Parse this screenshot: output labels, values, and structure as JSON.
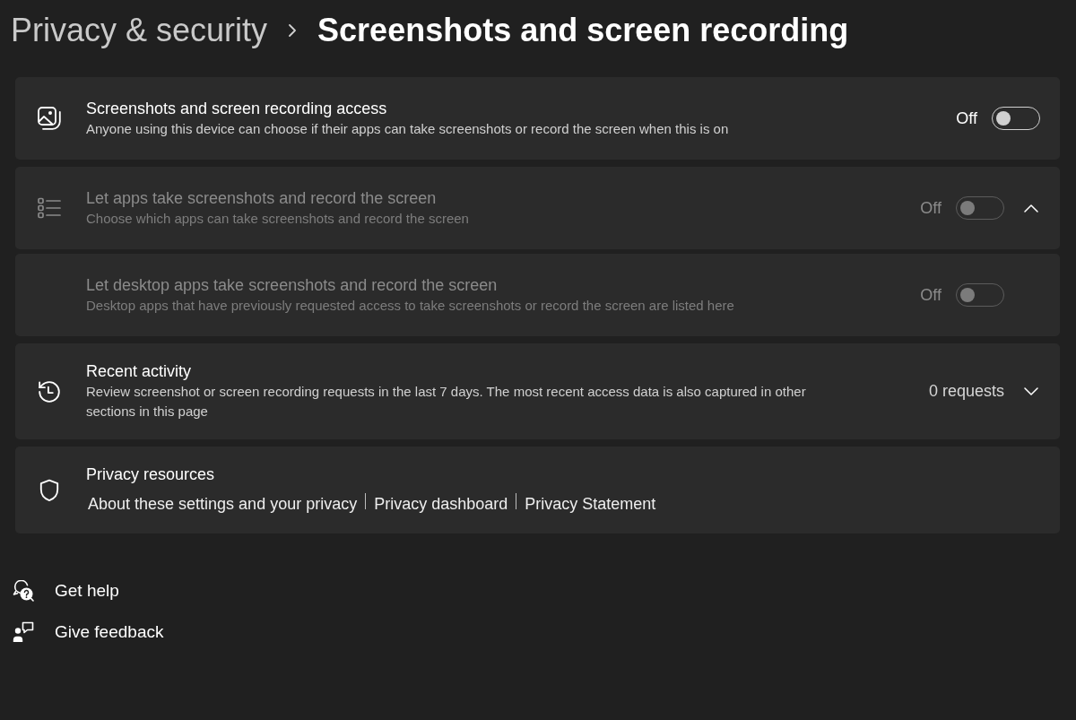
{
  "breadcrumb": {
    "parent": "Privacy & security",
    "current": "Screenshots and screen recording"
  },
  "settings": [
    {
      "kind": "toggle",
      "title": "Screenshots and screen recording access",
      "description": "Anyone using this device can choose if their apps can take screenshots or record the screen when this is on",
      "state_label": "Off",
      "on": false,
      "disabled": false
    },
    {
      "kind": "toggle",
      "title": "Let apps take screenshots and record the screen",
      "description": "Choose which apps can take screenshots and record the screen",
      "state_label": "Off",
      "on": false,
      "disabled": true,
      "expanded": true,
      "children": [
        {
          "kind": "toggle",
          "title": "Let desktop apps take screenshots and record the screen",
          "description": "Desktop apps that have previously requested access to take screenshots or record the screen are listed here",
          "state_label": "Off",
          "on": false,
          "disabled": true
        }
      ]
    },
    {
      "kind": "expander",
      "title": "Recent activity",
      "description": "Review screenshot or screen recording requests in the last 7 days. The most recent access data is also captured in other sections in this page",
      "value": "0 requests",
      "expanded": false
    },
    {
      "kind": "links",
      "title": "Privacy resources",
      "links": [
        "About these settings and your privacy",
        "Privacy dashboard",
        "Privacy Statement"
      ]
    }
  ],
  "help_links": [
    {
      "label": "Get help"
    },
    {
      "label": "Give feedback"
    }
  ]
}
